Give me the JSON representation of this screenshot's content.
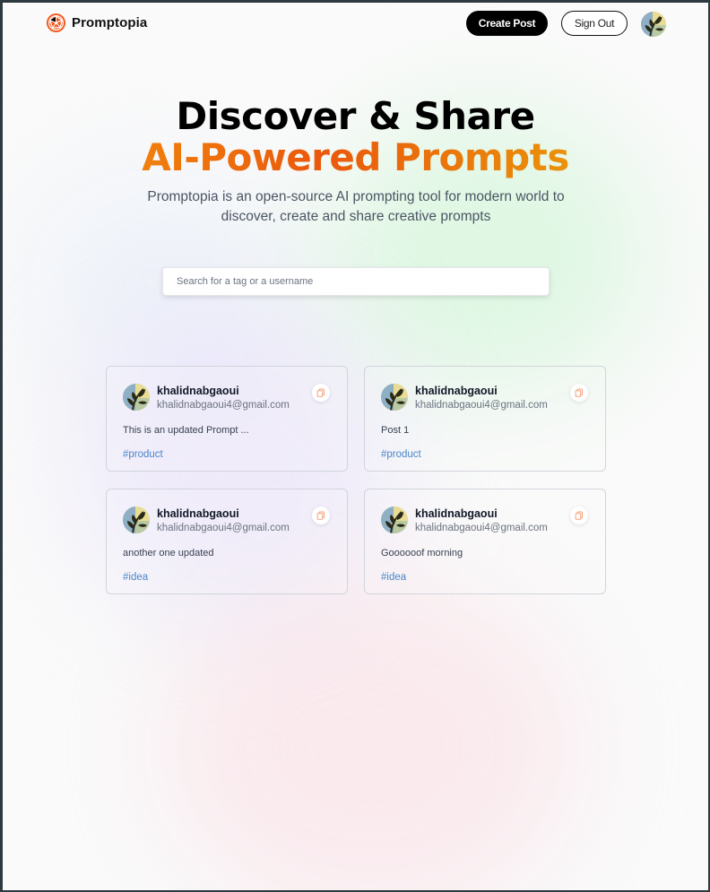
{
  "app": {
    "name": "Promptopia",
    "logo_icon": "globe-network-logo-icon"
  },
  "nav": {
    "create_post_label": "Create Post",
    "sign_out_label": "Sign Out",
    "avatar_icon": "profile-avatar-icon"
  },
  "hero": {
    "title_line1": "Discover & Share",
    "title_line2": "AI-Powered Prompts",
    "description": "Promptopia is an open-source AI prompting tool for modern world to discover, create and share creative prompts"
  },
  "search": {
    "placeholder": "Search for a tag or a username",
    "value": ""
  },
  "colors": {
    "gradient_start": "#f59e0b",
    "gradient_mid": "#ea580c",
    "gradient_end": "#eab308",
    "tag_color": "#4a86c8",
    "button_primary": "#000000"
  },
  "posts": [
    {
      "username": "khalidnabgaoui",
      "email": "khalidnabgaoui4@gmail.com",
      "prompt": "This is an updated Prompt ...",
      "tag": "#product"
    },
    {
      "username": "khalidnabgaoui",
      "email": "khalidnabgaoui4@gmail.com",
      "prompt": "Post 1",
      "tag": "#product"
    },
    {
      "username": "khalidnabgaoui",
      "email": "khalidnabgaoui4@gmail.com",
      "prompt": "another one updated",
      "tag": "#idea"
    },
    {
      "username": "khalidnabgaoui",
      "email": "khalidnabgaoui4@gmail.com",
      "prompt": "Goooooof morning",
      "tag": "#idea"
    }
  ]
}
